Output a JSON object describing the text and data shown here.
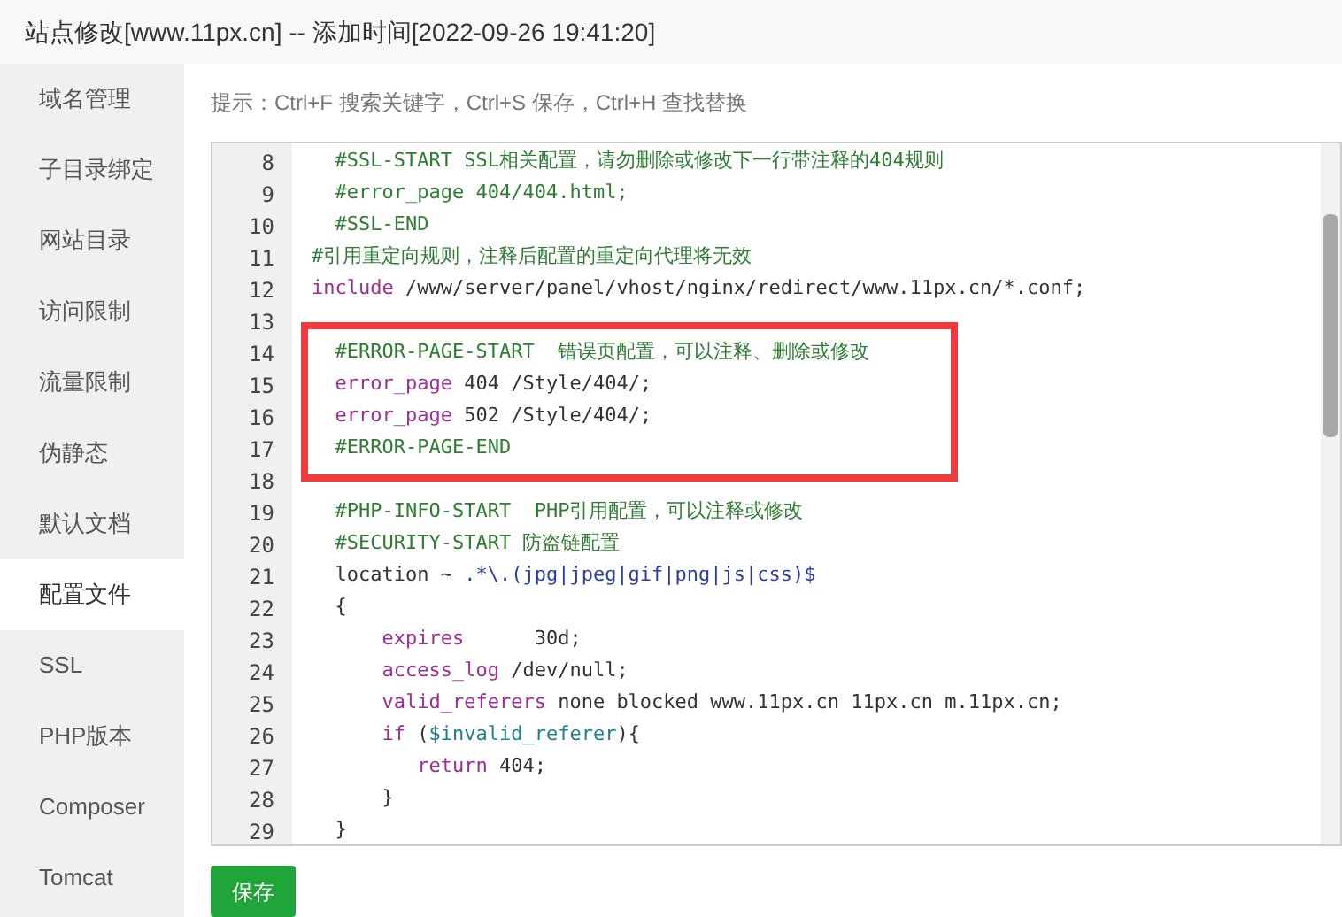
{
  "window": {
    "title": "站点修改[www.11px.cn] -- 添加时间[2022-09-26 19:41:20]"
  },
  "sidebar": {
    "items": [
      {
        "label": "域名管理",
        "selected": false
      },
      {
        "label": "子目录绑定",
        "selected": false
      },
      {
        "label": "网站目录",
        "selected": false
      },
      {
        "label": "访问限制",
        "selected": false
      },
      {
        "label": "流量限制",
        "selected": false
      },
      {
        "label": "伪静态",
        "selected": false
      },
      {
        "label": "默认文档",
        "selected": false
      },
      {
        "label": "配置文件",
        "selected": true
      },
      {
        "label": "SSL",
        "selected": false
      },
      {
        "label": "PHP版本",
        "selected": false
      },
      {
        "label": "Composer",
        "selected": false
      },
      {
        "label": "Tomcat",
        "selected": false
      }
    ]
  },
  "hint": "提示：Ctrl+F 搜索关键字，Ctrl+S 保存，Ctrl+H 查找替换",
  "editor": {
    "lines": [
      {
        "number": "8",
        "highlighted": false,
        "tokens": [
          {
            "kind": "comment",
            "text": "  #SSL-START SSL相关配置，请勿删除或修改下一行带注释的404规则"
          }
        ]
      },
      {
        "number": "9",
        "highlighted": false,
        "tokens": [
          {
            "kind": "comment",
            "text": "  #error_page 404/404.html;"
          }
        ]
      },
      {
        "number": "10",
        "highlighted": false,
        "tokens": [
          {
            "kind": "comment",
            "text": "  #SSL-END"
          }
        ]
      },
      {
        "number": "11",
        "highlighted": false,
        "tokens": [
          {
            "kind": "comment",
            "text": "#引用重定向规则，注释后配置的重定向代理将无效"
          }
        ]
      },
      {
        "number": "12",
        "highlighted": false,
        "tokens": [
          {
            "kind": "keyword",
            "text": "include"
          },
          {
            "kind": "plain",
            "text": " /www/server/panel/vhost/nginx/redirect/www.11px.cn/*.conf;"
          }
        ]
      },
      {
        "number": "13",
        "highlighted": false
      },
      {
        "number": "14",
        "highlighted": true,
        "tokens": [
          {
            "kind": "comment",
            "text": "  #ERROR-PAGE-START  错误页配置，可以注释、删除或修改"
          }
        ]
      },
      {
        "number": "15",
        "highlighted": true,
        "tokens": [
          {
            "kind": "keyword",
            "text": "  error_page"
          },
          {
            "kind": "plain",
            "text": " 404 /Style/404/;"
          }
        ]
      },
      {
        "number": "16",
        "highlighted": true,
        "tokens": [
          {
            "kind": "keyword",
            "text": "  error_page"
          },
          {
            "kind": "plain",
            "text": " 502 /Style/404/;"
          }
        ]
      },
      {
        "number": "17",
        "highlighted": true,
        "tokens": [
          {
            "kind": "comment",
            "text": "  #ERROR-PAGE-END"
          }
        ]
      },
      {
        "number": "18",
        "highlighted": false
      },
      {
        "number": "19",
        "highlighted": false,
        "tokens": [
          {
            "kind": "comment",
            "text": "  #PHP-INFO-START  PHP引用配置，可以注释或修改"
          }
        ]
      },
      {
        "number": "20",
        "highlighted": false,
        "tokens": [
          {
            "kind": "comment",
            "text": "  #SECURITY-START 防盗链配置"
          }
        ]
      },
      {
        "number": "21",
        "highlighted": false,
        "tokens": [
          {
            "kind": "plain",
            "text": "  location ~ "
          },
          {
            "kind": "regex",
            "text": ".*\\.(jpg|jpeg|gif|png|js|css)$"
          }
        ]
      },
      {
        "number": "22",
        "highlighted": false,
        "tokens": [
          {
            "kind": "plain",
            "text": "  {"
          }
        ]
      },
      {
        "number": "23",
        "highlighted": false,
        "tokens": [
          {
            "kind": "keyword",
            "text": "      expires"
          },
          {
            "kind": "plain",
            "text": "      30d;"
          }
        ]
      },
      {
        "number": "24",
        "highlighted": false,
        "tokens": [
          {
            "kind": "keyword",
            "text": "      access_log"
          },
          {
            "kind": "plain",
            "text": " /dev/null;"
          }
        ]
      },
      {
        "number": "25",
        "highlighted": false,
        "tokens": [
          {
            "kind": "keyword",
            "text": "      valid_referers"
          },
          {
            "kind": "plain",
            "text": " none blocked www.11px.cn 11px.cn m.11px.cn;"
          }
        ]
      },
      {
        "number": "26",
        "highlighted": false,
        "tokens": [
          {
            "kind": "keyword",
            "text": "      if"
          },
          {
            "kind": "plain",
            "text": " ("
          },
          {
            "kind": "variable",
            "text": "$invalid_referer"
          },
          {
            "kind": "plain",
            "text": "){"
          }
        ]
      },
      {
        "number": "27",
        "highlighted": false,
        "tokens": [
          {
            "kind": "keyword",
            "text": "         return"
          },
          {
            "kind": "plain",
            "text": " 404;"
          }
        ]
      },
      {
        "number": "28",
        "highlighted": false,
        "tokens": [
          {
            "kind": "plain",
            "text": "      }"
          }
        ]
      },
      {
        "number": "29",
        "highlighted": false,
        "tokens": [
          {
            "kind": "plain",
            "text": "  }"
          }
        ]
      }
    ]
  },
  "save_button": "保存"
}
